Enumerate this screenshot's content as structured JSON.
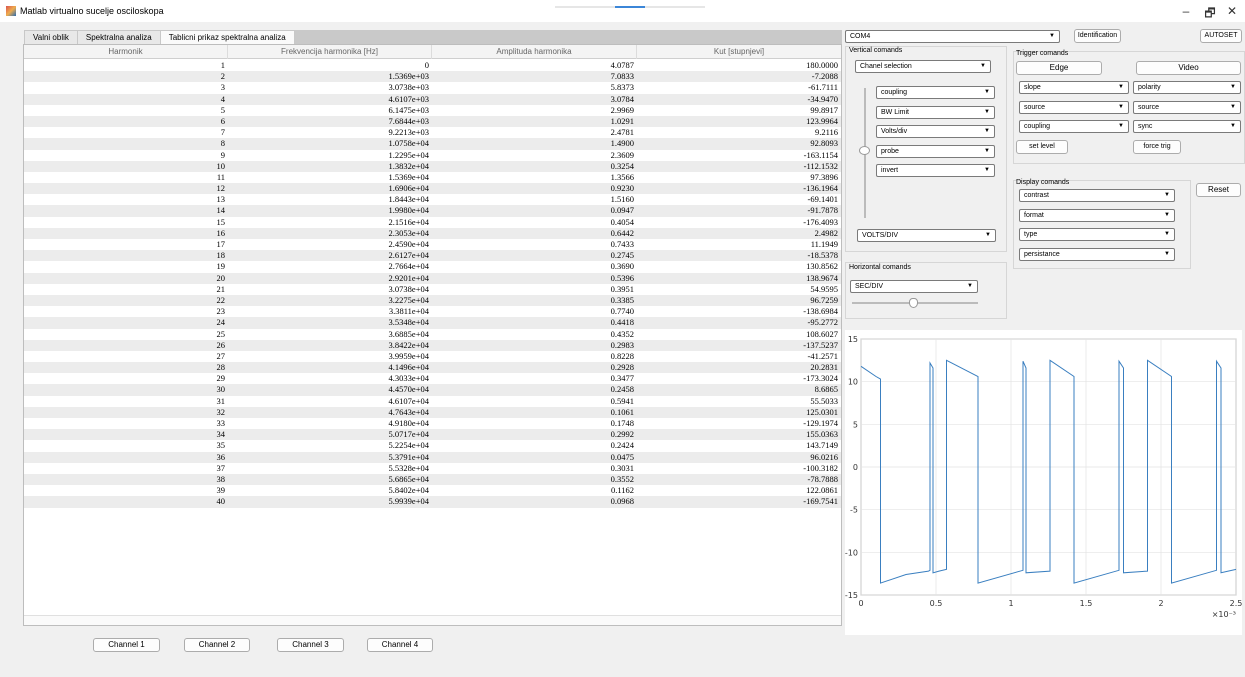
{
  "window": {
    "title": "Matlab virtualno sucelje osciloskopa",
    "min": "–",
    "max": "🗗",
    "close": "✕"
  },
  "tabs": [
    "Valni oblik",
    "Spektralna analiza",
    "Tablicni prikaz spektralna analiza"
  ],
  "table": {
    "headers": [
      "Harmonik",
      "Frekvencija harmonika [Hz]",
      "Amplituda harmonika",
      "Kut [stupnjevi]"
    ],
    "rows": [
      [
        "1",
        "0",
        "4.0787",
        "180.0000"
      ],
      [
        "2",
        "1.5369e+03",
        "7.0833",
        "-7.2088"
      ],
      [
        "3",
        "3.0738e+03",
        "5.8373",
        "-61.7111"
      ],
      [
        "4",
        "4.6107e+03",
        "3.0784",
        "-34.9470"
      ],
      [
        "5",
        "6.1475e+03",
        "2.9969",
        "99.8917"
      ],
      [
        "6",
        "7.6844e+03",
        "1.0291",
        "123.9964"
      ],
      [
        "7",
        "9.2213e+03",
        "2.4781",
        "9.2116"
      ],
      [
        "8",
        "1.0758e+04",
        "1.4900",
        "92.8093"
      ],
      [
        "9",
        "1.2295e+04",
        "2.3609",
        "-163.1154"
      ],
      [
        "10",
        "1.3832e+04",
        "0.3254",
        "-112.1532"
      ],
      [
        "11",
        "1.5369e+04",
        "1.3566",
        "97.3896"
      ],
      [
        "12",
        "1.6906e+04",
        "0.9230",
        "-136.1964"
      ],
      [
        "13",
        "1.8443e+04",
        "1.5160",
        "-69.1401"
      ],
      [
        "14",
        "1.9980e+04",
        "0.0947",
        "-91.7878"
      ],
      [
        "15",
        "2.1516e+04",
        "0.4054",
        "-176.4093"
      ],
      [
        "16",
        "2.3053e+04",
        "0.6442",
        "2.4982"
      ],
      [
        "17",
        "2.4590e+04",
        "0.7433",
        "11.1949"
      ],
      [
        "18",
        "2.6127e+04",
        "0.2745",
        "-18.5378"
      ],
      [
        "19",
        "2.7664e+04",
        "0.3690",
        "130.8562"
      ],
      [
        "20",
        "2.9201e+04",
        "0.5396",
        "138.9674"
      ],
      [
        "21",
        "3.0738e+04",
        "0.3951",
        "54.9595"
      ],
      [
        "22",
        "3.2275e+04",
        "0.3385",
        "96.7259"
      ],
      [
        "23",
        "3.3811e+04",
        "0.7740",
        "-138.6984"
      ],
      [
        "24",
        "3.5348e+04",
        "0.4418",
        "-95.2772"
      ],
      [
        "25",
        "3.6885e+04",
        "0.4352",
        "108.6027"
      ],
      [
        "26",
        "3.8422e+04",
        "0.2983",
        "-137.5237"
      ],
      [
        "27",
        "3.9959e+04",
        "0.8228",
        "-41.2571"
      ],
      [
        "28",
        "4.1496e+04",
        "0.2928",
        "20.2831"
      ],
      [
        "29",
        "4.3033e+04",
        "0.3477",
        "-173.3024"
      ],
      [
        "30",
        "4.4570e+04",
        "0.2458",
        "8.6865"
      ],
      [
        "31",
        "4.6107e+04",
        "0.5941",
        "55.5033"
      ],
      [
        "32",
        "4.7643e+04",
        "0.1061",
        "125.0301"
      ],
      [
        "33",
        "4.9180e+04",
        "0.1748",
        "-129.1974"
      ],
      [
        "34",
        "5.0717e+04",
        "0.2992",
        "155.0363"
      ],
      [
        "35",
        "5.2254e+04",
        "0.2424",
        "143.7149"
      ],
      [
        "36",
        "5.3791e+04",
        "0.0475",
        "96.0216"
      ],
      [
        "37",
        "5.5328e+04",
        "0.3031",
        "-100.3182"
      ],
      [
        "38",
        "5.6865e+04",
        "0.3552",
        "-78.7888"
      ],
      [
        "39",
        "5.8402e+04",
        "0.1162",
        "122.0861"
      ],
      [
        "40",
        "5.9939e+04",
        "0.0968",
        "-169.7541"
      ]
    ]
  },
  "channels": [
    "Channel 1",
    "Channel 2",
    "Channel 3",
    "Channel 4"
  ],
  "port": {
    "value": "COM4",
    "identification": "Identification",
    "autoset": "AUTOSET"
  },
  "vertical": {
    "label": "Vertical comands",
    "channel_selection": "Chanel selection",
    "options": [
      "coupling",
      "BW Limit",
      "Volts/div",
      "probe",
      "invert"
    ],
    "volts_div": "VOLTS/DIV"
  },
  "trigger": {
    "label": "Trigger comands",
    "edge": "Edge",
    "video": "Video",
    "left": [
      "slope",
      "source",
      "coupling"
    ],
    "right": [
      "polarity",
      "source",
      "sync"
    ],
    "set_level": "set level",
    "force_trig": "force trig"
  },
  "display": {
    "label": "Display comands",
    "options": [
      "contrast",
      "format",
      "type",
      "persistance"
    ],
    "reset": "Reset"
  },
  "horizontal": {
    "label": "Horizontal comands",
    "sec_div": "SEC/DIV"
  },
  "chart_data": {
    "type": "line",
    "title": "",
    "xlabel": "",
    "ylabel": "",
    "xlim": [
      0,
      0.0025
    ],
    "ylim": [
      -15,
      15
    ],
    "x_ticks": [
      "0",
      "0.5",
      "1",
      "1.5",
      "2",
      "2.5"
    ],
    "y_ticks": [
      "15",
      "10",
      "5",
      "0",
      "-5",
      "-10",
      "-15"
    ],
    "x_exponent": "×10⁻³",
    "grid": true,
    "series": [
      {
        "color": "#3a7fc0",
        "x": [
          0.0,
          0.0001,
          0.00013,
          0.00013,
          0.0003,
          0.00045,
          0.00046,
          0.00046,
          0.00048,
          0.00048,
          0.00052,
          0.00052,
          0.00057,
          0.00057,
          0.00078,
          0.00078,
          0.00108,
          0.00108,
          0.0011,
          0.0011,
          0.00126,
          0.00126,
          0.00142,
          0.00142,
          0.00172,
          0.00172,
          0.00175,
          0.00175,
          0.00191,
          0.00191,
          0.00207,
          0.00207,
          0.00237,
          0.00237,
          0.0024,
          0.0024,
          0.0025
        ],
        "y": [
          11.8,
          10.6,
          10.3,
          -13.6,
          -12.6,
          -12.2,
          -12.1,
          12.2,
          11.6,
          -12.4,
          -12.2,
          -12.2,
          -12.0,
          12.5,
          10.6,
          -13.6,
          -12.1,
          12.4,
          11.6,
          -12.4,
          -12.2,
          12.5,
          10.6,
          -13.6,
          -12.1,
          12.4,
          11.6,
          -12.4,
          -12.2,
          12.5,
          10.6,
          -13.6,
          -12.1,
          12.4,
          11.6,
          -12.4,
          -12.0
        ]
      }
    ]
  }
}
